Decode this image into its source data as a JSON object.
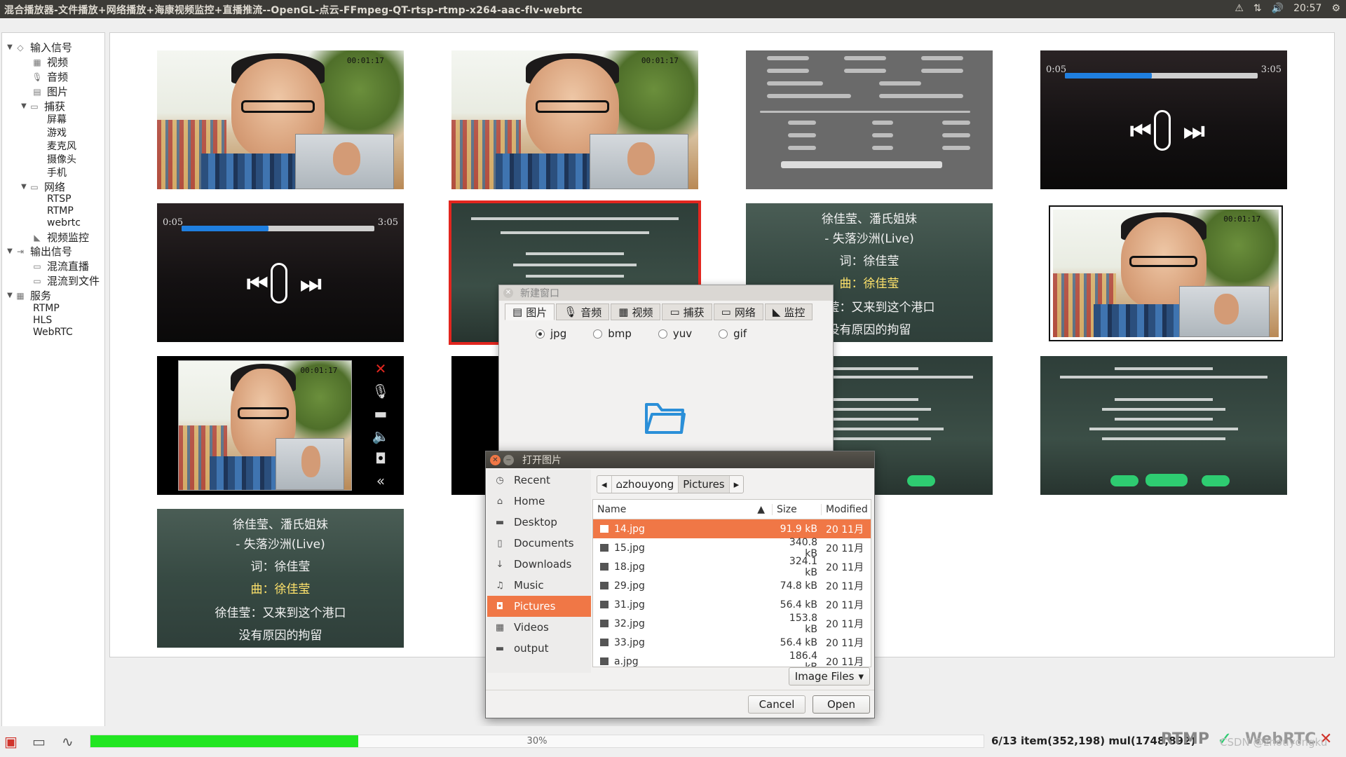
{
  "app": {
    "title": "混合播放器-文件播放+网络播放+海康视频监控+直播推流--OpenGL-点云-FFmpeg-QT-rtsp-rtmp-x264-aac-flv-webrtc",
    "clock": "20:57"
  },
  "tree": {
    "input_signal": "输入信号",
    "video": "视频",
    "audio": "音频",
    "image": "图片",
    "capture": "捕获",
    "screen": "屏幕",
    "game": "游戏",
    "microphone": "麦克风",
    "camera": "摄像头",
    "phone": "手机",
    "network": "网络",
    "rtsp": "RTSP",
    "rtmp": "RTMP",
    "webrtc": "webrtc",
    "video_monitor": "视频监控",
    "output_signal": "输出信号",
    "mix_live": "混流直播",
    "mix_file": "混流到文件",
    "service": "服务",
    "svc_rtmp": "RTMP",
    "svc_hls": "HLS",
    "svc_webrtc": "WebRTC"
  },
  "tiles": {
    "timestamp": "00:01:17",
    "player_left": "0:05",
    "player_right": "3:05",
    "player_progress": 0.45,
    "lyrics": {
      "line1": "徐佳莹、潘氏姐妹",
      "line2": "- 失落沙洲(Live)",
      "line3": "词：徐佳莹",
      "line4": "曲：徐佳莹",
      "line5": "徐佳莹：又来到这个港口",
      "line6": "没有原因的拘留"
    }
  },
  "new_window": {
    "title": "新建窗口",
    "tabs": [
      "图片",
      "音频",
      "视频",
      "捕获",
      "网络",
      "监控"
    ],
    "formats": [
      "jpg",
      "bmp",
      "yuv",
      "gif"
    ],
    "selected_format": "jpg"
  },
  "file_dialog": {
    "title": "打开图片",
    "places": [
      "Recent",
      "Home",
      "Desktop",
      "Documents",
      "Downloads",
      "Music",
      "Pictures",
      "Videos",
      "output"
    ],
    "active_place": "Pictures",
    "path": [
      "zhouyong",
      "Pictures"
    ],
    "columns": {
      "name": "Name",
      "size": "Size",
      "modified": "Modified"
    },
    "files": [
      {
        "name": "14.jpg",
        "size": "91.9 kB",
        "modified": "20 11月"
      },
      {
        "name": "15.jpg",
        "size": "340.8 kB",
        "modified": "20 11月"
      },
      {
        "name": "18.jpg",
        "size": "324.1 kB",
        "modified": "20 11月"
      },
      {
        "name": "29.jpg",
        "size": "74.8 kB",
        "modified": "20 11月"
      },
      {
        "name": "31.jpg",
        "size": "56.4 kB",
        "modified": "20 11月"
      },
      {
        "name": "32.jpg",
        "size": "153.8 kB",
        "modified": "20 11月"
      },
      {
        "name": "33.jpg",
        "size": "56.4 kB",
        "modified": "20 11月"
      },
      {
        "name": "a.jpg",
        "size": "186.4 kB",
        "modified": "20 11月"
      }
    ],
    "filter": "Image Files",
    "cancel": "Cancel",
    "open": "Open"
  },
  "status": {
    "progress": 0.3,
    "progress_text": "30%",
    "info": "6/13 item(352,198) mul(1748,892)",
    "rtmp": "RTMP",
    "webrtc": "WebRTC",
    "watermark": "CSDN @zhouyongku"
  },
  "colors": {
    "accent": "#f07746",
    "selection_border": "#e2261f",
    "progress_fill": "#22e622",
    "player_bar": "#1f7fe0"
  }
}
